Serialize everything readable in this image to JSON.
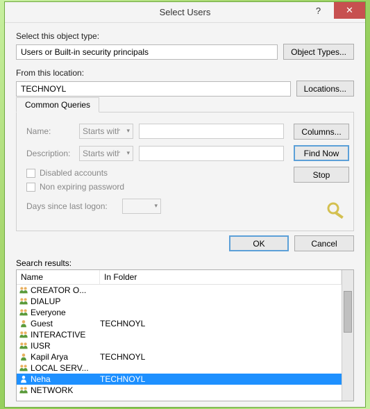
{
  "titlebar": {
    "title": "Select Users"
  },
  "labels": {
    "object_type": "Select this object type:",
    "from_location": "From this location:",
    "search_results": "Search results:"
  },
  "fields": {
    "object_type_value": "Users or Built-in security principals",
    "location_value": "TECHNOYL"
  },
  "buttons": {
    "object_types": "Object Types...",
    "locations": "Locations...",
    "columns": "Columns...",
    "find_now": "Find Now",
    "stop": "Stop",
    "ok": "OK",
    "cancel": "Cancel"
  },
  "tab": {
    "label": "Common Queries"
  },
  "queries": {
    "name_label": "Name:",
    "desc_label": "Description:",
    "starts_with": "Starts with",
    "disabled_accounts": "Disabled accounts",
    "non_expiring": "Non expiring password",
    "days_logon": "Days since last logon:"
  },
  "columns": {
    "name": "Name",
    "folder": "In Folder"
  },
  "results": [
    {
      "name": "CREATOR O...",
      "folder": "",
      "type": "group"
    },
    {
      "name": "DIALUP",
      "folder": "",
      "type": "group"
    },
    {
      "name": "Everyone",
      "folder": "",
      "type": "group"
    },
    {
      "name": "Guest",
      "folder": "TECHNOYL",
      "type": "user"
    },
    {
      "name": "INTERACTIVE",
      "folder": "",
      "type": "group"
    },
    {
      "name": "IUSR",
      "folder": "",
      "type": "group"
    },
    {
      "name": "Kapil Arya",
      "folder": "TECHNOYL",
      "type": "user"
    },
    {
      "name": "LOCAL SERV...",
      "folder": "",
      "type": "group"
    },
    {
      "name": "Neha",
      "folder": "TECHNOYL",
      "type": "user",
      "selected": true
    },
    {
      "name": "NETWORK",
      "folder": "",
      "type": "group"
    }
  ]
}
